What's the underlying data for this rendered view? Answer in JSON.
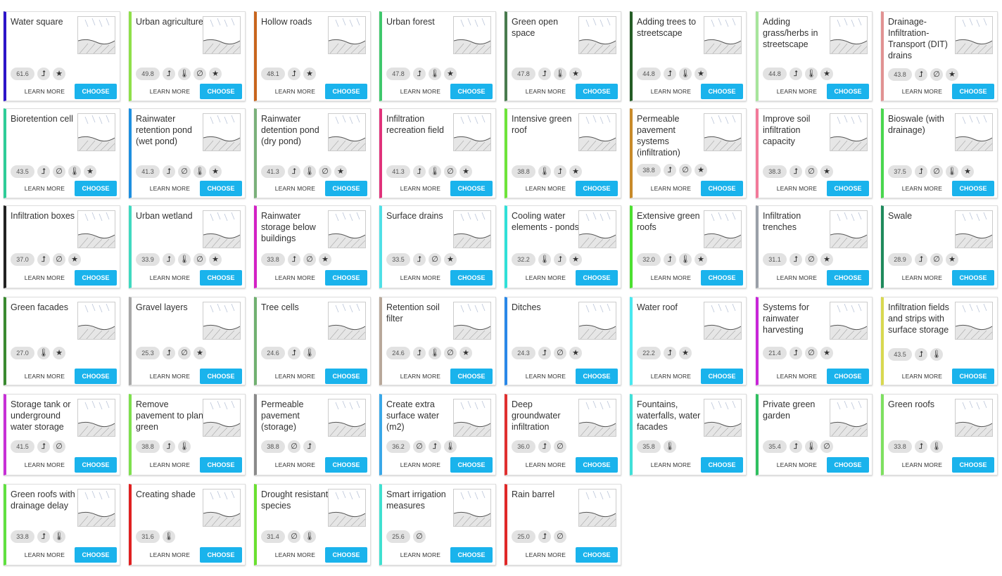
{
  "buttons": {
    "learn_more": "LEARN MORE",
    "choose": "CHOOSE"
  },
  "icon_glyphs": {
    "runoff": "⮥",
    "heat": "🌡",
    "drought": "∅",
    "star": "★"
  },
  "measures": [
    {
      "title": "Water square",
      "score": "61.6",
      "icons": [
        "runoff",
        "star"
      ],
      "color": "#2d15c9"
    },
    {
      "title": "Urban agriculture",
      "score": "49.8",
      "icons": [
        "runoff",
        "heat",
        "drought",
        "star"
      ],
      "color": "#8fe04a"
    },
    {
      "title": "Hollow roads",
      "score": "48.1",
      "icons": [
        "runoff",
        "star"
      ],
      "color": "#c8651d"
    },
    {
      "title": "Urban forest",
      "score": "47.8",
      "icons": [
        "runoff",
        "heat",
        "star"
      ],
      "color": "#3fc86c"
    },
    {
      "title": "Green open space",
      "score": "47.8",
      "icons": [
        "runoff",
        "heat",
        "star"
      ],
      "color": "#497b4e"
    },
    {
      "title": "Adding trees to streetscape",
      "score": "44.8",
      "icons": [
        "runoff",
        "heat",
        "star"
      ],
      "color": "#245c25"
    },
    {
      "title": "Adding grass/herbs in streetscape",
      "score": "44.8",
      "icons": [
        "runoff",
        "heat",
        "star"
      ],
      "color": "#a7e59c"
    },
    {
      "title": "Drainage-Infiltration-Transport (DIT) drains",
      "score": "43.8",
      "icons": [
        "runoff",
        "drought",
        "star"
      ],
      "color": "#e19292"
    },
    {
      "title": "Bioretention cell",
      "score": "43.5",
      "icons": [
        "runoff",
        "drought",
        "heat",
        "star"
      ],
      "color": "#2ecc98"
    },
    {
      "title": "Rainwater retention pond (wet pond)",
      "score": "41.3",
      "icons": [
        "runoff",
        "drought",
        "heat",
        "star"
      ],
      "color": "#1e8fe0"
    },
    {
      "title": "Rainwater detention pond (dry pond)",
      "score": "41.3",
      "icons": [
        "runoff",
        "heat",
        "drought",
        "star"
      ],
      "color": "#7ab07a"
    },
    {
      "title": "Infiltration recreation field",
      "score": "41.3",
      "icons": [
        "runoff",
        "heat",
        "drought",
        "star"
      ],
      "color": "#e0327a"
    },
    {
      "title": "Intensive green roof",
      "score": "38.8",
      "icons": [
        "heat",
        "runoff",
        "star"
      ],
      "color": "#6ee43a"
    },
    {
      "title": "Permeable pavement systems (infiltration)",
      "score": "38.8",
      "icons": [
        "runoff",
        "drought",
        "star"
      ],
      "color": "#c88a2a"
    },
    {
      "title": "Improve soil infiltration capacity",
      "score": "38.3",
      "icons": [
        "runoff",
        "drought",
        "star"
      ],
      "color": "#f27a9a"
    },
    {
      "title": "Bioswale (with drainage)",
      "score": "37.5",
      "icons": [
        "runoff",
        "drought",
        "heat",
        "star"
      ],
      "color": "#49d64e"
    },
    {
      "title": "Infiltration boxes",
      "score": "37.0",
      "icons": [
        "runoff",
        "drought",
        "star"
      ],
      "color": "#222222"
    },
    {
      "title": "Urban wetland",
      "score": "33.9",
      "icons": [
        "runoff",
        "heat",
        "drought",
        "star"
      ],
      "color": "#40d9c0"
    },
    {
      "title": "Rainwater storage below buildings",
      "score": "33.8",
      "icons": [
        "runoff",
        "drought",
        "star"
      ],
      "color": "#d321c5"
    },
    {
      "title": "Surface drains",
      "score": "33.5",
      "icons": [
        "runoff",
        "drought",
        "star"
      ],
      "color": "#50e0e6"
    },
    {
      "title": "Cooling water elements - ponds",
      "score": "32.2",
      "icons": [
        "heat",
        "runoff",
        "star"
      ],
      "color": "#30e0d8"
    },
    {
      "title": "Extensive green roofs",
      "score": "32.0",
      "icons": [
        "runoff",
        "heat",
        "star"
      ],
      "color": "#4ce030"
    },
    {
      "title": "Infiltration trenches",
      "score": "31.1",
      "icons": [
        "runoff",
        "drought",
        "star"
      ],
      "color": "#9aa0a8"
    },
    {
      "title": "Swale",
      "score": "28.9",
      "icons": [
        "runoff",
        "drought",
        "star"
      ],
      "color": "#1f8a5c"
    },
    {
      "title": "Green facades",
      "score": "27.0",
      "icons": [
        "heat",
        "star"
      ],
      "color": "#3a8a30"
    },
    {
      "title": "Gravel layers",
      "score": "25.3",
      "icons": [
        "runoff",
        "drought",
        "star"
      ],
      "color": "#a8a8a8"
    },
    {
      "title": "Tree cells",
      "score": "24.6",
      "icons": [
        "runoff",
        "heat"
      ],
      "color": "#70b070"
    },
    {
      "title": "Retention soil filter",
      "score": "24.6",
      "icons": [
        "runoff",
        "heat",
        "drought",
        "star"
      ],
      "color": "#b8a89a"
    },
    {
      "title": "Ditches",
      "score": "24.3",
      "icons": [
        "runoff",
        "drought",
        "star"
      ],
      "color": "#2a88e8"
    },
    {
      "title": "Water roof",
      "score": "22.2",
      "icons": [
        "runoff",
        "star"
      ],
      "color": "#48e8f0"
    },
    {
      "title": "Systems for rainwater harvesting",
      "score": "21.4",
      "icons": [
        "runoff",
        "drought",
        "star"
      ],
      "color": "#c826d8"
    },
    {
      "title": "Infiltration fields and strips with surface storage",
      "score": "43.5",
      "icons": [
        "runoff",
        "heat"
      ],
      "color": "#d8d850"
    },
    {
      "title": "Storage tank or underground water storage",
      "score": "41.5",
      "icons": [
        "runoff",
        "drought"
      ],
      "color": "#c730d6"
    },
    {
      "title": "Remove pavement to plant green",
      "score": "38.8",
      "icons": [
        "runoff",
        "heat"
      ],
      "color": "#7ee04e"
    },
    {
      "title": "Permeable pavement (storage)",
      "score": "38.8",
      "icons": [
        "drought",
        "runoff"
      ],
      "color": "#8a8a8a"
    },
    {
      "title": "Create extra surface water (m2)",
      "score": "36.2",
      "icons": [
        "drought",
        "runoff",
        "heat"
      ],
      "color": "#3aa8e8"
    },
    {
      "title": "Deep groundwater infiltration",
      "score": "36.0",
      "icons": [
        "runoff",
        "drought"
      ],
      "color": "#e03030"
    },
    {
      "title": "Fountains, waterfalls, water facades",
      "score": "35.8",
      "icons": [
        "heat"
      ],
      "color": "#40e0d8"
    },
    {
      "title": "Private green garden",
      "score": "35.4",
      "icons": [
        "runoff",
        "heat",
        "drought"
      ],
      "color": "#30c060"
    },
    {
      "title": "Green roofs",
      "score": "33.8",
      "icons": [
        "runoff",
        "heat"
      ],
      "color": "#7ee060"
    },
    {
      "title": "Green roofs with drainage delay",
      "score": "33.8",
      "icons": [
        "runoff",
        "heat"
      ],
      "color": "#60e040"
    },
    {
      "title": "Creating shade",
      "score": "31.6",
      "icons": [
        "heat"
      ],
      "color": "#e02020"
    },
    {
      "title": "Drought resistant species",
      "score": "31.4",
      "icons": [
        "drought",
        "heat"
      ],
      "color": "#6ae030"
    },
    {
      "title": "Smart irrigation measures",
      "score": "25.6",
      "icons": [
        "drought"
      ],
      "color": "#40e0d0"
    },
    {
      "title": "Rain barrel",
      "score": "25.0",
      "icons": [
        "runoff",
        "drought"
      ],
      "color": "#e02828"
    }
  ]
}
